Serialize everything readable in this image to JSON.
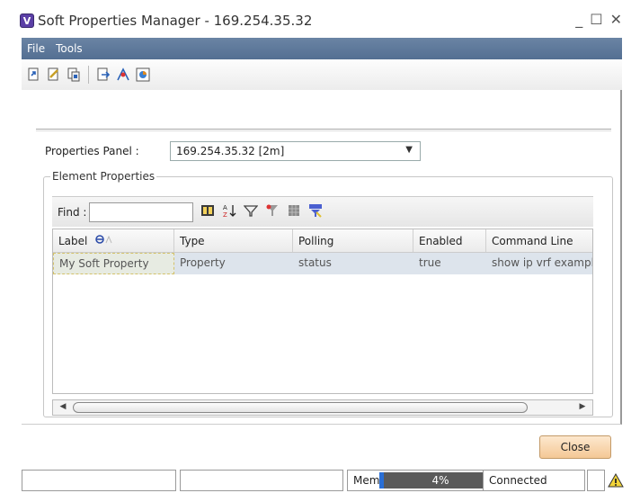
{
  "window": {
    "title": "Soft Properties Manager - 169.254.35.32",
    "logo_letter": "V",
    "min": "_",
    "max": "☐",
    "close": "✕"
  },
  "menu": [
    {
      "label": "File"
    },
    {
      "label": "Tools"
    }
  ],
  "toolbar": {
    "icons": [
      "import-icon",
      "edit-icon",
      "copy-icon",
      "export-icon",
      "merge-icon",
      "report-icon"
    ]
  },
  "properties_panel": {
    "label": "Properties Panel :",
    "selected": "169.254.35.32 [2m]"
  },
  "element_properties": {
    "legend": "Element Properties",
    "find_label": "Find :",
    "find_value": "",
    "columns": [
      "Label",
      "Type",
      "Polling",
      "Enabled",
      "Command Line"
    ],
    "rows": [
      {
        "label": "My Soft Property",
        "type": "Property",
        "polling": "status",
        "enabled": "true",
        "command": "show ip vrf example"
      }
    ]
  },
  "buttons": {
    "close": "Close"
  },
  "status": {
    "memory_label": "Memory:",
    "memory_value": "4%",
    "memory_fraction": 0.04,
    "connection": "Connected"
  },
  "colors": {
    "menu_bg": "#5f7a9c",
    "close_btn": "#f4c895",
    "row_selected": "#dde4ec"
  }
}
